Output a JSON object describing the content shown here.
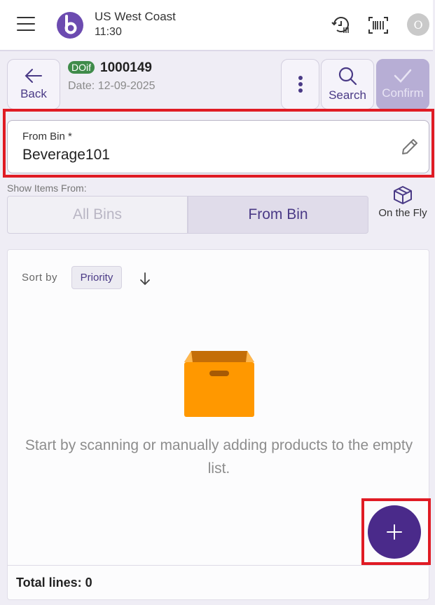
{
  "topbar": {
    "menu_icon": "hamburger-icon",
    "logo_icon": "brand-logo",
    "location": "US West Coast",
    "time": "11:30",
    "history_icon": "history-scan-icon",
    "barcode_icon": "barcode-icon",
    "avatar_initial": "O"
  },
  "header": {
    "back_label": "Back",
    "doc_badge": "DOif",
    "doc_number": "1000149",
    "doc_date": "Date: 12-09-2025",
    "more_icon": "more-vertical-icon",
    "search_label": "Search",
    "confirm_label": "Confirm"
  },
  "from_bin": {
    "label": "From Bin *",
    "value": "Beverage101",
    "edit_icon": "pencil-icon"
  },
  "show_items": {
    "label": "Show Items From:",
    "options": [
      "All Bins",
      "From Bin"
    ],
    "selected": "From Bin",
    "on_the_fly_label": "On the Fly",
    "on_the_fly_icon": "cube-icon"
  },
  "list": {
    "sort_label": "Sort by",
    "sort_value": "Priority",
    "sort_direction": "descending",
    "empty_message": "Start by scanning or manually adding products to the empty list.",
    "add_icon": "plus-icon",
    "total_lines": "Total lines: 0"
  },
  "colors": {
    "primary": "#4a2a8a",
    "highlight": "#e01b24",
    "badge": "#3f8b4a",
    "box": "#ff9800"
  }
}
